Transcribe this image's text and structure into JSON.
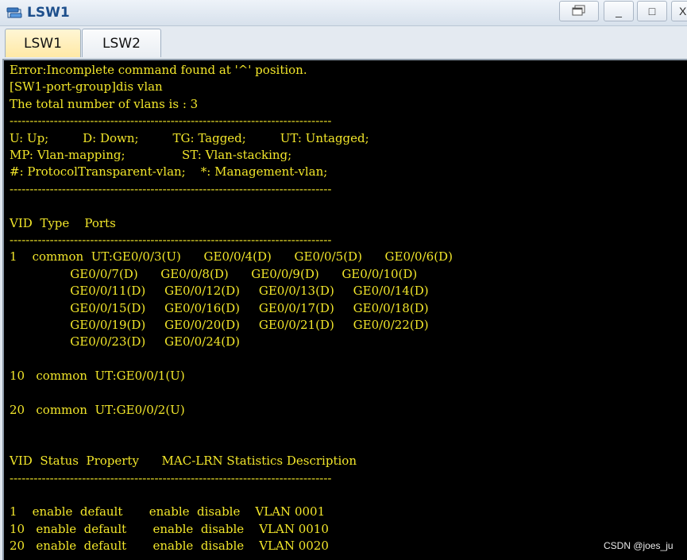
{
  "window": {
    "title": "LSW1",
    "icon": "switch-icon",
    "controls": {
      "restore": "restore-icon",
      "minimize": "_",
      "maximize": "□",
      "close": "X"
    }
  },
  "tabs": [
    {
      "label": "LSW1",
      "active": true
    },
    {
      "label": "LSW2",
      "active": false
    }
  ],
  "terminal": {
    "lines": [
      "Error:Incomplete command found at '^' position.",
      "[SW1-port-group]dis vlan",
      "The total number of vlans is : 3",
      "--------------------------------------------------------------------------------",
      "U: Up;         D: Down;         TG: Tagged;         UT: Untagged;",
      "MP: Vlan-mapping;               ST: Vlan-stacking;",
      "#: ProtocolTransparent-vlan;    *: Management-vlan;",
      "--------------------------------------------------------------------------------",
      "",
      "VID  Type    Ports",
      "--------------------------------------------------------------------------------",
      "1    common  UT:GE0/0/3(U)      GE0/0/4(D)      GE0/0/5(D)      GE0/0/6(D)",
      "                GE0/0/7(D)      GE0/0/8(D)      GE0/0/9(D)      GE0/0/10(D)",
      "                GE0/0/11(D)     GE0/0/12(D)     GE0/0/13(D)     GE0/0/14(D)",
      "                GE0/0/15(D)     GE0/0/16(D)     GE0/0/17(D)     GE0/0/18(D)",
      "                GE0/0/19(D)     GE0/0/20(D)     GE0/0/21(D)     GE0/0/22(D)",
      "                GE0/0/23(D)     GE0/0/24(D)",
      "",
      "10   common  UT:GE0/0/1(U)",
      "",
      "20   common  UT:GE0/0/2(U)",
      "",
      "",
      "VID  Status  Property      MAC-LRN Statistics Description",
      "--------------------------------------------------------------------------------",
      "",
      "1    enable  default       enable  disable    VLAN 0001",
      "10   enable  default       enable  disable    VLAN 0010",
      "20   enable  default       enable  disable    VLAN 0020"
    ]
  },
  "watermark": "CSDN @joes_ju"
}
